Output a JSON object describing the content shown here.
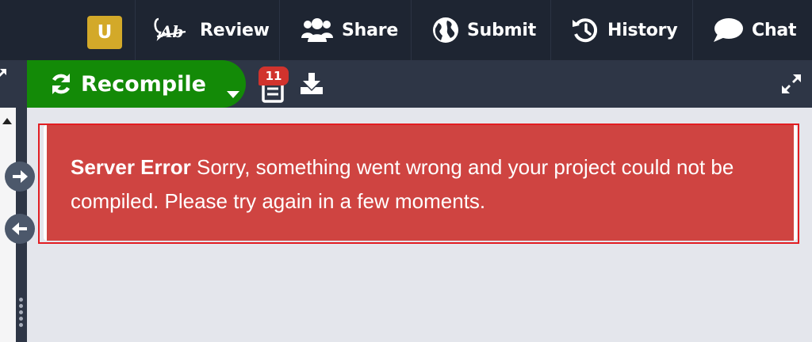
{
  "user": {
    "initial": "U"
  },
  "nav": {
    "review": "Review",
    "share": "Share",
    "submit": "Submit",
    "history": "History",
    "chat": "Chat",
    "review_icon_text": "Ab"
  },
  "toolbar": {
    "recompile_label": "Recompile",
    "logs_count": "11"
  },
  "error": {
    "title": "Server Error",
    "message": "Sorry, something went wrong and your project could not be compiled. Please try again in a few moments."
  },
  "colors": {
    "topbar": "#1e2532",
    "toolbar": "#2e3646",
    "recompile": "#138a07",
    "error_bg": "#cf4441",
    "error_outline": "#e21d22",
    "badge": "#d1332d",
    "avatar": "#d3a929"
  },
  "icons": {
    "review": "review-ab-icon",
    "share": "users-icon",
    "submit": "globe-icon",
    "history": "history-icon",
    "chat": "chat-bubble-icon",
    "recompile": "refresh-icon",
    "logs": "document-icon",
    "download": "download-icon",
    "expand": "expand-icon"
  }
}
